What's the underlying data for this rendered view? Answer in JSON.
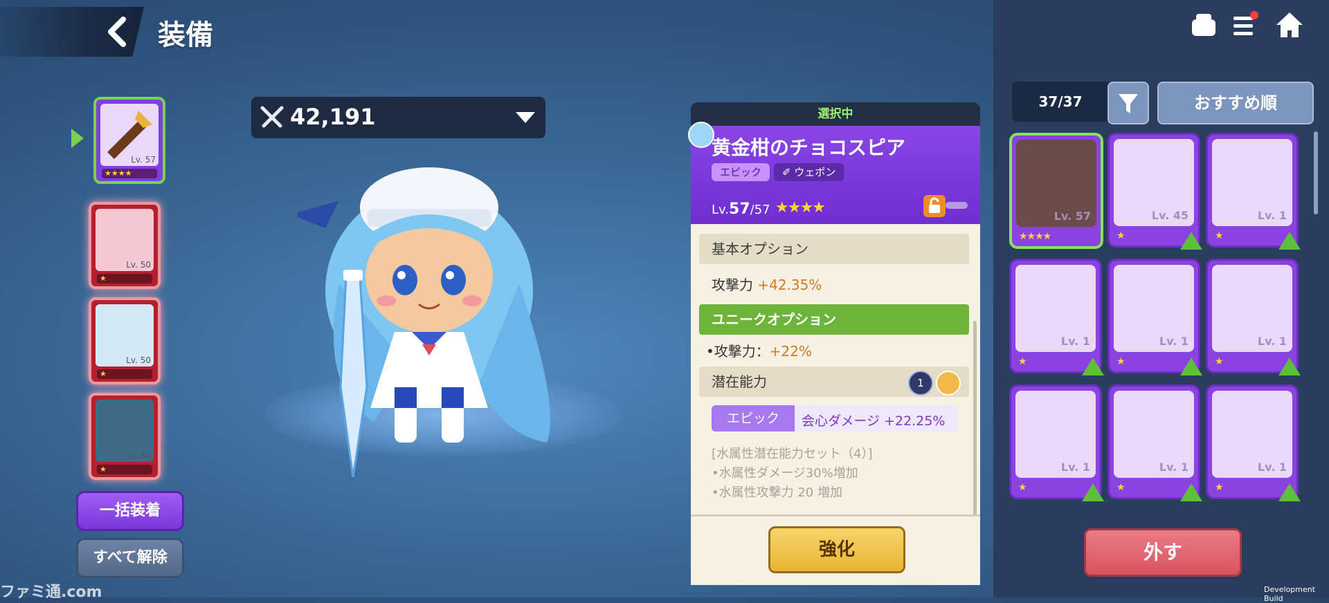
{
  "header": {
    "title": "装備"
  },
  "top_icons": [
    "chef-hat-icon",
    "menu-icon",
    "home-icon"
  ],
  "power": {
    "value": "42,191"
  },
  "slots": [
    {
      "level": "Lv. 57",
      "stars": "★★★★"
    },
    {
      "level": "Lv. 50",
      "stars": "★"
    },
    {
      "level": "Lv. 50",
      "stars": "★"
    },
    {
      "level": "Lv. 50",
      "stars": "★"
    }
  ],
  "left_buttons": {
    "equip_all": "一括装着",
    "unequip_all": "すべて解除"
  },
  "detail": {
    "status": "選択中",
    "name": "黄金柑のチョコスピア",
    "rarity": "エピック",
    "type": "ウェポン",
    "level_prefix": "Lv.",
    "level": "57",
    "level_max": "/57",
    "stars": "★★★★",
    "base_option_title": "基本オプション",
    "base_stat_label": "攻撃力",
    "base_stat_value": "+42.35%",
    "unique_option_title": "ユニークオプション",
    "unique_stat_label": "•攻撃力：",
    "unique_stat_value": "+22%",
    "potential_title": "潜在能力",
    "potential_count": "1",
    "potential_rarity": "エピック",
    "potential_stat": "会心ダメージ +22.25%",
    "set_title": "[水属性潜在能力セット（4）]",
    "set_line1": "•水属性ダメージ30%増加",
    "set_line2": "•水属性攻撃力 20 増加",
    "enhance_label": "強化"
  },
  "inventory": {
    "count": "37/37",
    "sort_label": "おすすめ順",
    "items": [
      {
        "level": "Lv. 57",
        "stars": "★★★★",
        "selected": true
      },
      {
        "level": "Lv. 45",
        "stars": "★"
      },
      {
        "level": "Lv. 1",
        "stars": "★"
      },
      {
        "level": "Lv. 1",
        "stars": "★"
      },
      {
        "level": "Lv. 1",
        "stars": "★"
      },
      {
        "level": "Lv. 1",
        "stars": "★"
      },
      {
        "level": "Lv. 1",
        "stars": "★"
      },
      {
        "level": "Lv. 1",
        "stars": "★"
      },
      {
        "level": "Lv. 1",
        "stars": "★"
      }
    ],
    "unequip_label": "外す"
  },
  "footer": {
    "dev_build": "Development Build",
    "watermark": "ファミ通.com"
  },
  "colors": {
    "accent_purple": "#8a45e6",
    "unique_green": "#6fb43a",
    "enhance_gold": "#e9b534",
    "unequip_red": "#d8545f"
  }
}
